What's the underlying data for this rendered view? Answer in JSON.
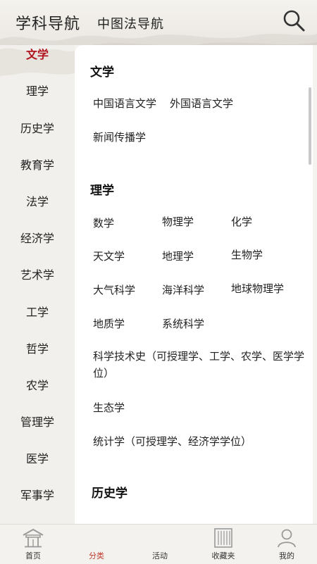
{
  "header": {
    "tabs": [
      "学科导航",
      "中图法导航"
    ]
  },
  "sidebar": {
    "items": [
      "文学",
      "理学",
      "历史学",
      "教育学",
      "法学",
      "经济学",
      "艺术学",
      "工学",
      "哲学",
      "农学",
      "管理学",
      "医学",
      "军事学"
    ],
    "active_index": 0
  },
  "content": {
    "sections": [
      {
        "title": "文学",
        "items": [
          "中国语言文学",
          "外国语言文学",
          "新闻传播学"
        ]
      },
      {
        "title": "理学",
        "items": [
          "数学",
          "物理学",
          "化学",
          "天文学",
          "地理学",
          "生物学",
          "大气科学",
          "海洋科学",
          "地球物理学",
          "地质学",
          "系统科学",
          "科学技术史（可授理学、工学、农学、医学学位）",
          "生态学",
          "统计学（可授理学、经济学学位）"
        ]
      },
      {
        "title": "历史学",
        "items": []
      }
    ]
  },
  "bottom_nav": {
    "items": [
      "首页",
      "分类",
      "活动",
      "收藏夹",
      "我的"
    ],
    "active_index": 1
  },
  "colors": {
    "accent": "#b0141e",
    "nav_active": "#c0392b"
  }
}
